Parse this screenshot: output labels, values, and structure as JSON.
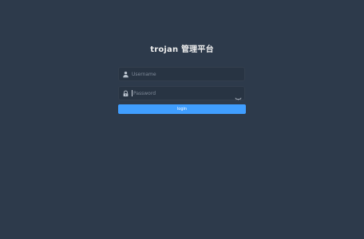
{
  "page": {
    "title": "trojan 管理平台"
  },
  "form": {
    "username": {
      "value": "",
      "placeholder": "Username",
      "icon": "user-icon"
    },
    "password": {
      "value": "",
      "placeholder": "Password",
      "icon": "lock-icon",
      "toggle_icon": "eye-closed-icon"
    },
    "login_label": "login"
  },
  "colors": {
    "background": "#2d3a4b",
    "input_background": "#283443",
    "primary": "#409eff",
    "title_text": "#eeeeee"
  }
}
